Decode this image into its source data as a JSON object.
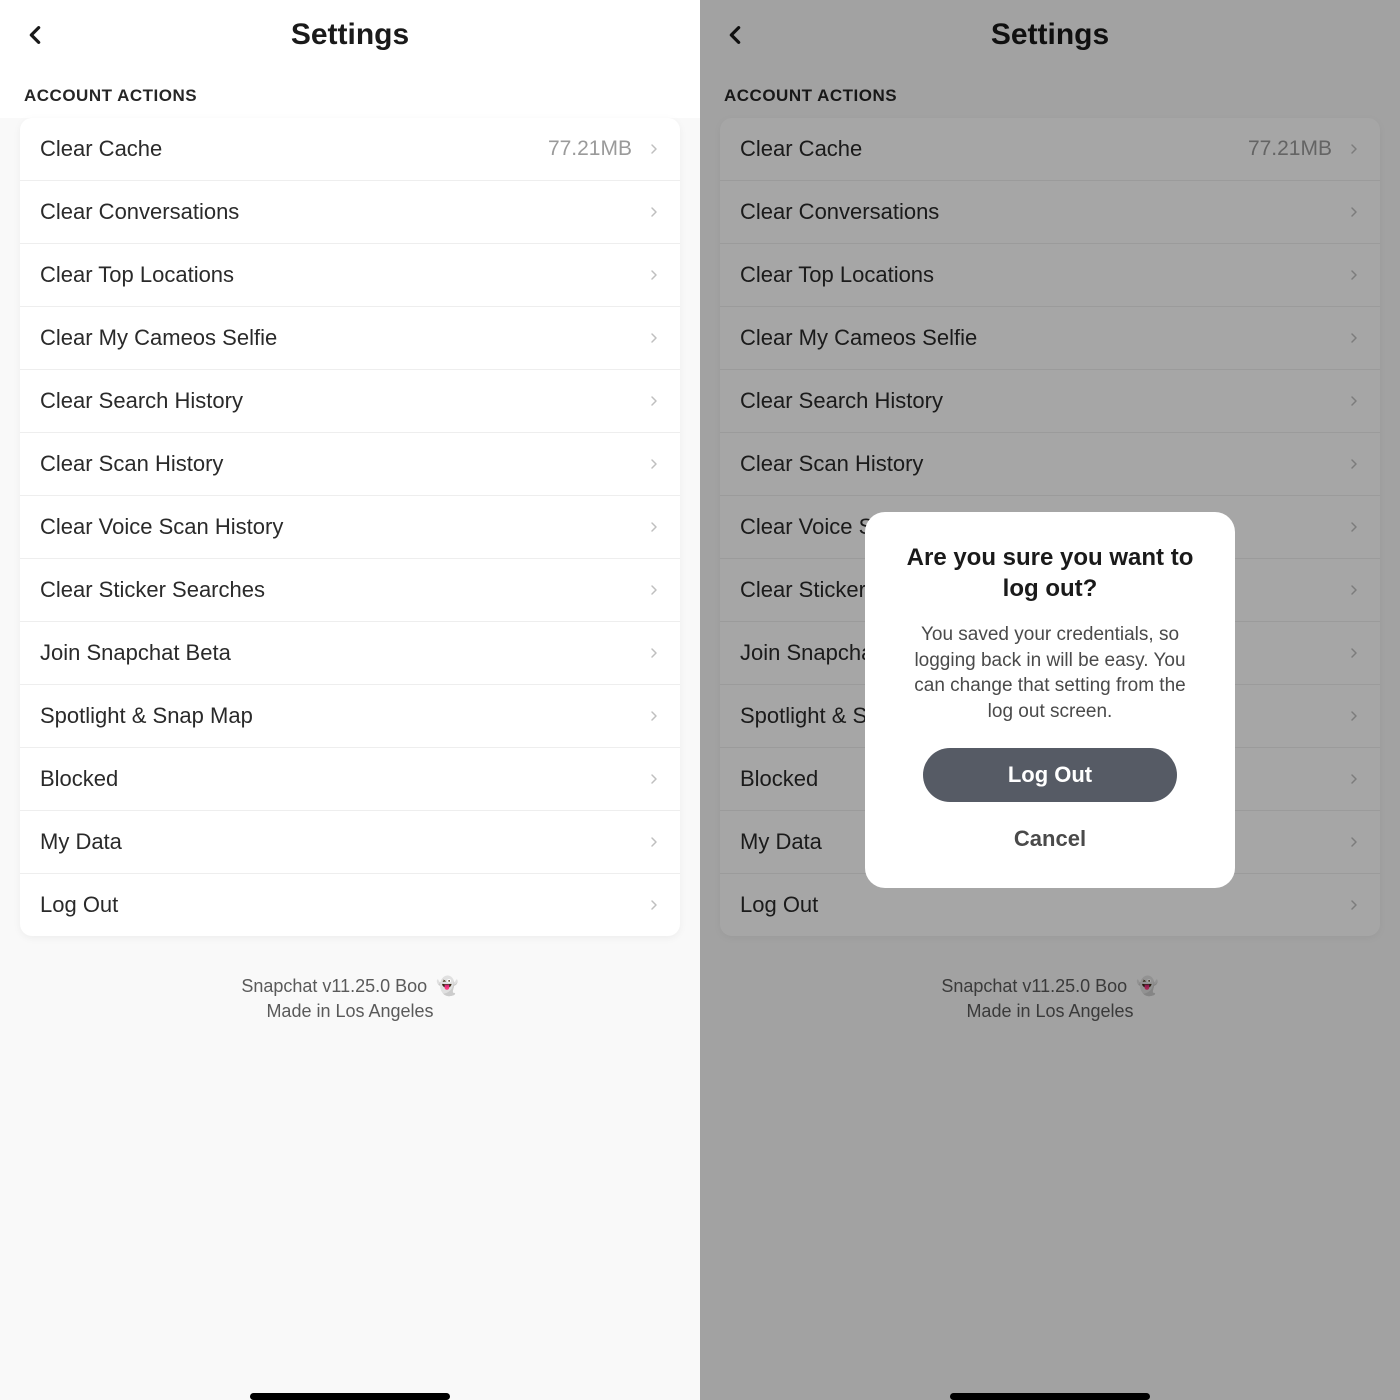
{
  "header": {
    "title": "Settings"
  },
  "section": {
    "header": "ACCOUNT ACTIONS"
  },
  "cache_value": "77.21MB",
  "items": [
    {
      "label": "Clear Cache",
      "value_key": "cache_value"
    },
    {
      "label": "Clear Conversations"
    },
    {
      "label": "Clear Top Locations"
    },
    {
      "label": "Clear My Cameos Selfie"
    },
    {
      "label": "Clear Search History"
    },
    {
      "label": "Clear Scan History"
    },
    {
      "label": "Clear Voice Scan History"
    },
    {
      "label": "Clear Sticker Searches"
    },
    {
      "label": "Join Snapchat Beta"
    },
    {
      "label": "Spotlight & Snap Map"
    },
    {
      "label": "Blocked"
    },
    {
      "label": "My Data"
    },
    {
      "label": "Log Out"
    }
  ],
  "footer": {
    "version": "Snapchat v11.25.0 Boo",
    "ghost_emoji": "👻",
    "made_in": "Made in Los Angeles"
  },
  "modal": {
    "title": "Are you sure you want to log out?",
    "body": "You saved your credentials, so logging back in will be easy. You can change that setting from the log out screen.",
    "primary": "Log Out",
    "secondary": "Cancel"
  }
}
